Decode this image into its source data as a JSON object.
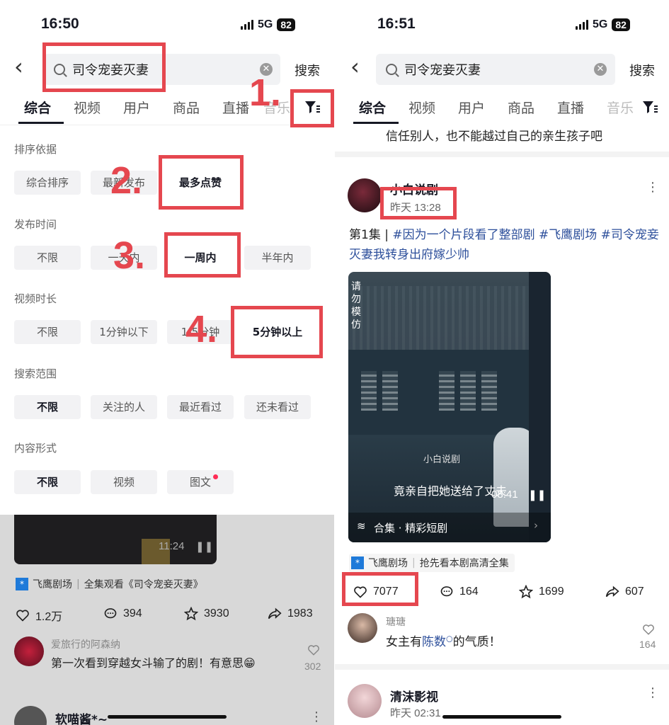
{
  "left": {
    "status": {
      "time": "16:50",
      "network": "5G",
      "battery": "82"
    },
    "search": {
      "query": "司令宠妾灭妻",
      "button": "搜索"
    },
    "tabs": [
      "综合",
      "视频",
      "用户",
      "商品",
      "直播",
      "音乐"
    ],
    "filters": {
      "sort": {
        "label": "排序依据",
        "options": [
          "综合排序",
          "最新发布",
          "最多点赞"
        ],
        "selected": "最多点赞"
      },
      "time": {
        "label": "发布时间",
        "options": [
          "不限",
          "一天内",
          "一周内",
          "半年内"
        ],
        "selected": "一周内"
      },
      "duration": {
        "label": "视频时长",
        "options": [
          "不限",
          "1分钟以下",
          "1-5分钟",
          "5分钟以上"
        ],
        "selected": "5分钟以上"
      },
      "scope": {
        "label": "搜索范围",
        "options": [
          "不限",
          "关注的人",
          "最近看过",
          "还未看过"
        ],
        "selected": "不限"
      },
      "form": {
        "label": "内容形式",
        "options": [
          "不限",
          "视频",
          "图文"
        ],
        "selected": "不限"
      }
    },
    "annotations": [
      "1.",
      "2.",
      "3.",
      "4."
    ],
    "below": {
      "video_duration": "11:24",
      "source": "飞鹰剧场",
      "source_desc": "全集观看《司令宠妾灭妻》",
      "likes": "1.2万",
      "comments": "394",
      "favorites": "3930",
      "shares": "1983",
      "comment_user": "爱旅行的阿森纳",
      "comment_text": "第一次看到穿越女斗输了的剧！有意思😁",
      "comment_likes": "302",
      "next_user": "软喵酱*~"
    }
  },
  "right": {
    "status": {
      "time": "16:51",
      "network": "5G",
      "battery": "82"
    },
    "search": {
      "query": "司令宠妾灭妻",
      "button": "搜索"
    },
    "tabs": [
      "综合",
      "视频",
      "用户",
      "商品",
      "直播",
      "音乐"
    ],
    "prev_text": "信任别人，也不能越过自己的亲生孩子吧",
    "post": {
      "author": "小白说剧",
      "time": "昨天 13:28",
      "caption_prefix": "第1集 | ",
      "caption_tags": "#因为一个片段看了整部剧 #飞鹰剧场 #司令宠妾灭妻我转身出府嫁少帅",
      "watermark_vertical": "请勿模仿",
      "watermark": "小白说剧",
      "subtitle": "竟亲自把她送给了丈夫",
      "duration": "08:41",
      "collection": "合集 · 精彩短剧",
      "source": "飞鹰剧场",
      "source_desc": "抢先看本剧高清全集",
      "likes": "7077",
      "comments": "164",
      "favorites": "1699",
      "shares": "607",
      "comment_user": "瑭瑭",
      "comment_text_a": "女主有",
      "comment_link": "陈数",
      "comment_text_b": "的气质！",
      "comment_likes": "164"
    },
    "next": {
      "author": "清沫影视",
      "time": "昨天 02:31"
    }
  },
  "colors": {
    "annotation_red": "#e5474f",
    "link_blue": "#2d4f9b"
  }
}
